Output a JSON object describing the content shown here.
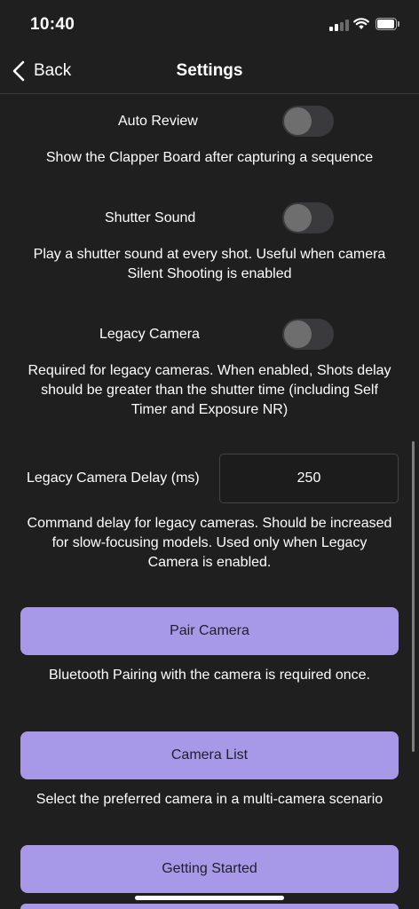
{
  "status_bar": {
    "time": "10:40"
  },
  "nav": {
    "back_label": "Back",
    "title": "Settings"
  },
  "settings": {
    "auto_review": {
      "label": "Auto Review",
      "enabled": false,
      "description": "Show the Clapper Board after capturing a sequence"
    },
    "shutter_sound": {
      "label": "Shutter Sound",
      "enabled": false,
      "description_line1": "Play a shutter sound at every shot. Useful when camera",
      "description_line2": "Silent Shooting is enabled"
    },
    "legacy_camera": {
      "label": "Legacy Camera",
      "enabled": false,
      "description_line1": "Required for legacy cameras. When enabled, Shots delay",
      "description_line2": "should be greater than the shutter time (including Self",
      "description_line3": "Timer and Exposure NR)"
    },
    "legacy_camera_delay": {
      "label": "Legacy Camera Delay (ms)",
      "value": "250",
      "description_line1": "Command delay for legacy cameras. Should be increased",
      "description_line2": "for slow-focusing models. Used only when Legacy",
      "description_line3": "Camera is enabled."
    }
  },
  "buttons": {
    "pair_camera": {
      "label": "Pair Camera",
      "description": "Bluetooth Pairing with the camera is required once."
    },
    "camera_list": {
      "label": "Camera List",
      "description": "Select the preferred camera in a multi-camera scenario"
    },
    "getting_started": {
      "label": "Getting Started"
    }
  },
  "colors": {
    "background": "#1f1f1f",
    "button": "#a899e8",
    "toggle_track": "#3a3a3c",
    "toggle_knob": "#6e6e6e"
  }
}
